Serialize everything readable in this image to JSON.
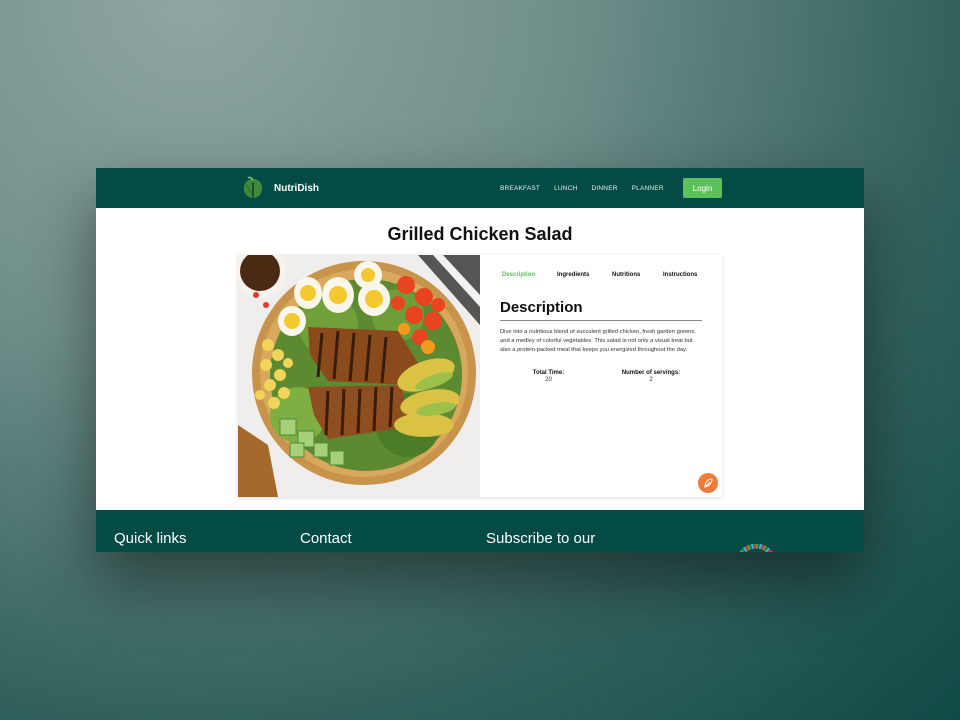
{
  "nav": {
    "brand": "NutriDish",
    "links": [
      "BREAKFAST",
      "LUNCH",
      "DINNER",
      "PLANNER"
    ],
    "login": "Login"
  },
  "page": {
    "title": "Grilled Chicken Salad"
  },
  "card": {
    "tabs": [
      "Description",
      "Ingredients",
      "Nutritions",
      "Instructions"
    ],
    "active_tab": "Description",
    "heading": "Description",
    "text": "Dive into a nutritious blend of succulent grilled chicken, fresh garden greens, and a medley of colorful vegetables. This salad is not only a visual treat but also a protein-packed meal that keeps you energized throughout the day.",
    "total_time_label": "Total Time:",
    "total_time_value": "20",
    "servings_label": "Number of servings:",
    "servings_value": "2",
    "fab_icon": "leaf-icon"
  },
  "footer": {
    "quick_links": "Quick links",
    "contact": "Contact",
    "subscribe": "Subscribe to our"
  },
  "colors": {
    "primary": "#044a45",
    "accent": "#5cc15a",
    "fab": "#f07a3a"
  }
}
